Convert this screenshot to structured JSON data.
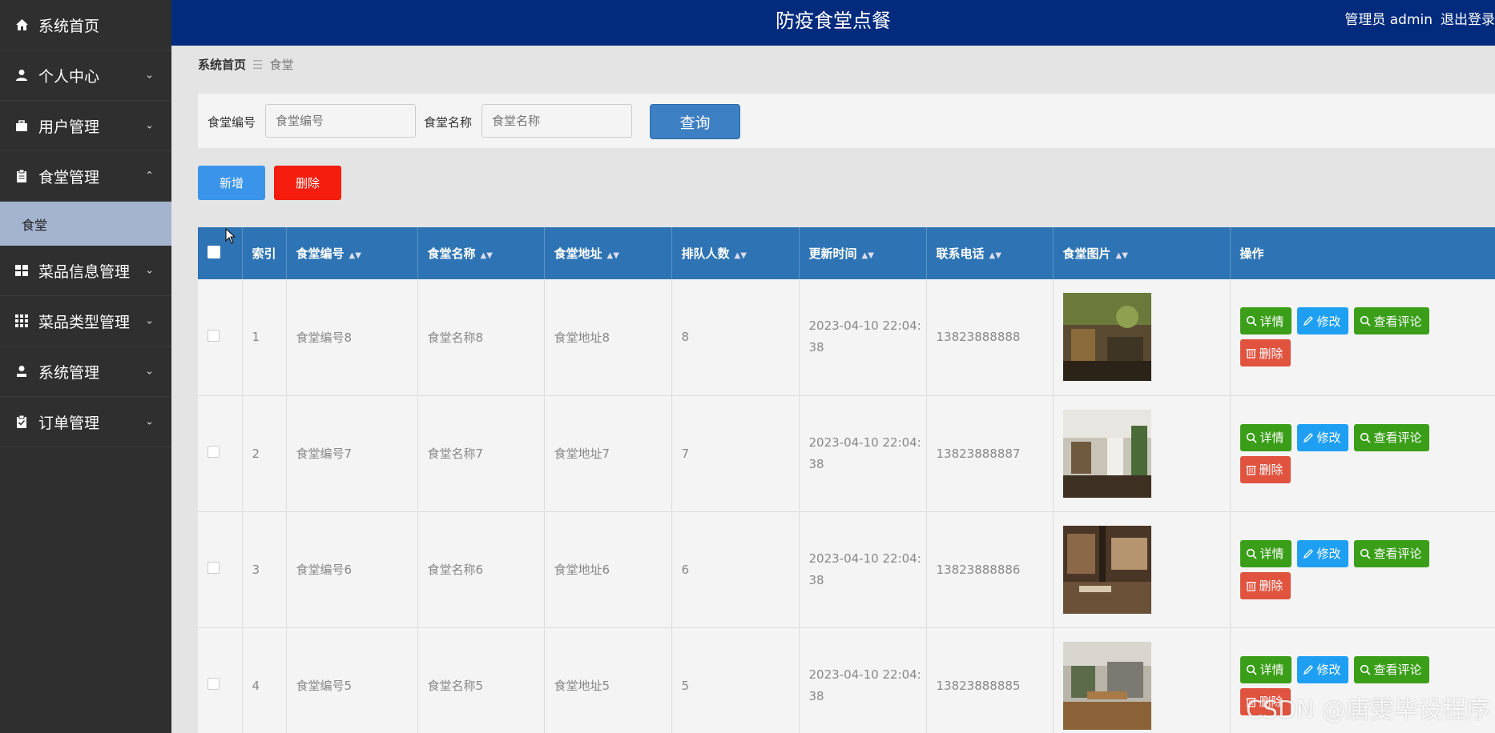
{
  "header": {
    "title": "防疫食堂点餐",
    "user": "管理员 admin",
    "logout": "退出登录"
  },
  "sidebar": {
    "items": [
      {
        "label": "系统首页",
        "icon": "home-icon"
      },
      {
        "label": "个人中心",
        "icon": "person-icon"
      },
      {
        "label": "用户管理",
        "icon": "briefcase-icon"
      },
      {
        "label": "食堂管理",
        "icon": "clipboard-icon",
        "sub": "食堂"
      },
      {
        "label": "菜品信息管理",
        "icon": "grid-icon"
      },
      {
        "label": "菜品类型管理",
        "icon": "grid9-icon"
      },
      {
        "label": "系统管理",
        "icon": "person-icon"
      },
      {
        "label": "订单管理",
        "icon": "checklist-icon"
      }
    ]
  },
  "breadcrumb": {
    "home": "系统首页",
    "sep": "☰",
    "current": "食堂"
  },
  "search": {
    "label1": "食堂编号",
    "placeholder1": "食堂编号",
    "label2": "食堂名称",
    "placeholder2": "食堂名称",
    "query": "查询"
  },
  "actions": {
    "add": "新增",
    "delete": "删除"
  },
  "table": {
    "headers": [
      "索引",
      "食堂编号",
      "食堂名称",
      "食堂地址",
      "排队人数",
      "更新时间",
      "联系电话",
      "食堂图片",
      "操作"
    ],
    "rows": [
      {
        "index": "1",
        "code": "食堂编号8",
        "name": "食堂名称8",
        "addr": "食堂地址8",
        "queue": "8",
        "time1": "2023-04-10 22:04:",
        "time2": "38",
        "phone": "13823888888"
      },
      {
        "index": "2",
        "code": "食堂编号7",
        "name": "食堂名称7",
        "addr": "食堂地址7",
        "queue": "7",
        "time1": "2023-04-10 22:04:",
        "time2": "38",
        "phone": "13823888887"
      },
      {
        "index": "3",
        "code": "食堂编号6",
        "name": "食堂名称6",
        "addr": "食堂地址6",
        "queue": "6",
        "time1": "2023-04-10 22:04:",
        "time2": "38",
        "phone": "13823888886"
      },
      {
        "index": "4",
        "code": "食堂编号5",
        "name": "食堂名称5",
        "addr": "食堂地址5",
        "queue": "5",
        "time1": "2023-04-10 22:04:",
        "time2": "38",
        "phone": "13823888885"
      }
    ],
    "ops": {
      "detail": "详情",
      "edit": "修改",
      "comments": "查看评论",
      "delete": "删除"
    }
  },
  "watermark": "CSDN @唐雯毕设程序"
}
